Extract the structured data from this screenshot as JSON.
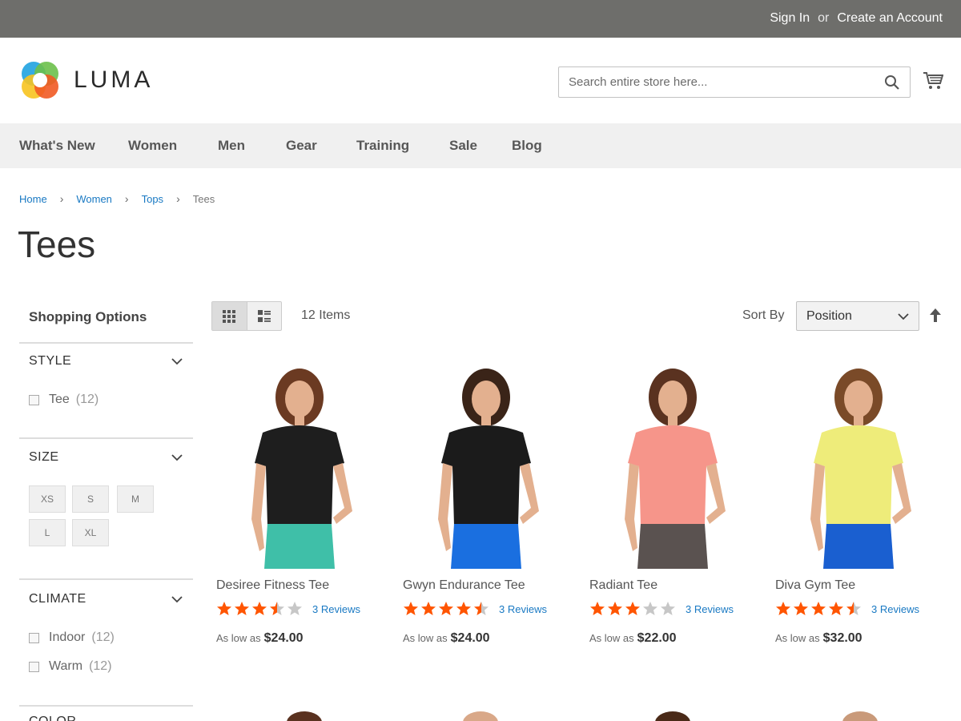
{
  "topbar": {
    "sign_in": "Sign In",
    "or": "or",
    "create_account": "Create an Account"
  },
  "logo": {
    "text": "LUMA"
  },
  "search": {
    "placeholder": "Search entire store here..."
  },
  "nav": [
    "What's New",
    "Women",
    "Men",
    "Gear",
    "Training",
    "Sale",
    "Blog"
  ],
  "breadcrumb": {
    "home": "Home",
    "women": "Women",
    "tops": "Tops",
    "current": "Tees",
    "separator": "›"
  },
  "page_title": "Tees",
  "sidebar": {
    "title": "Shopping Options",
    "style": {
      "label": "STYLE",
      "options": [
        {
          "label": "Tee",
          "count": "(12)"
        }
      ]
    },
    "size": {
      "label": "SIZE",
      "options": [
        "XS",
        "S",
        "M",
        "L",
        "XL"
      ]
    },
    "climate": {
      "label": "CLIMATE",
      "options": [
        {
          "label": "Indoor",
          "count": "(12)"
        },
        {
          "label": "Warm",
          "count": "(12)"
        }
      ]
    },
    "color": {
      "label": "COLOR"
    }
  },
  "toolbar": {
    "item_count": "12 Items",
    "sort_label": "Sort By",
    "sort_value": "Position"
  },
  "products": [
    {
      "name": "Desiree Fitness Tee",
      "rating": 3.5,
      "reviews": "3 Reviews",
      "price_label": "As low as",
      "price": "$24.00",
      "shirt_color": "#1e1e1e",
      "bottom_color": "#3fbfa8",
      "hair_color": "#6b3a22"
    },
    {
      "name": "Gwyn Endurance Tee",
      "rating": 4.5,
      "reviews": "3 Reviews",
      "price_label": "As low as",
      "price": "$24.00",
      "shirt_color": "#1b1b1b",
      "bottom_color": "#1a6fe0",
      "hair_color": "#3a2418"
    },
    {
      "name": "Radiant Tee",
      "rating": 3,
      "reviews": "3 Reviews",
      "price_label": "As low as",
      "price": "$22.00",
      "shirt_color": "#f6958a",
      "bottom_color": "#5a5250",
      "hair_color": "#5a3220"
    },
    {
      "name": "Diva Gym Tee",
      "rating": 4.5,
      "reviews": "3 Reviews",
      "price_label": "As low as",
      "price": "$32.00",
      "shirt_color": "#eeec7a",
      "bottom_color": "#1a5fd0",
      "hair_color": "#7a4a28"
    }
  ],
  "colors": {
    "star_filled": "#ff5501",
    "star_empty": "#c7c7c7",
    "link": "#1979c3",
    "topbar": "#6e6e6b"
  }
}
